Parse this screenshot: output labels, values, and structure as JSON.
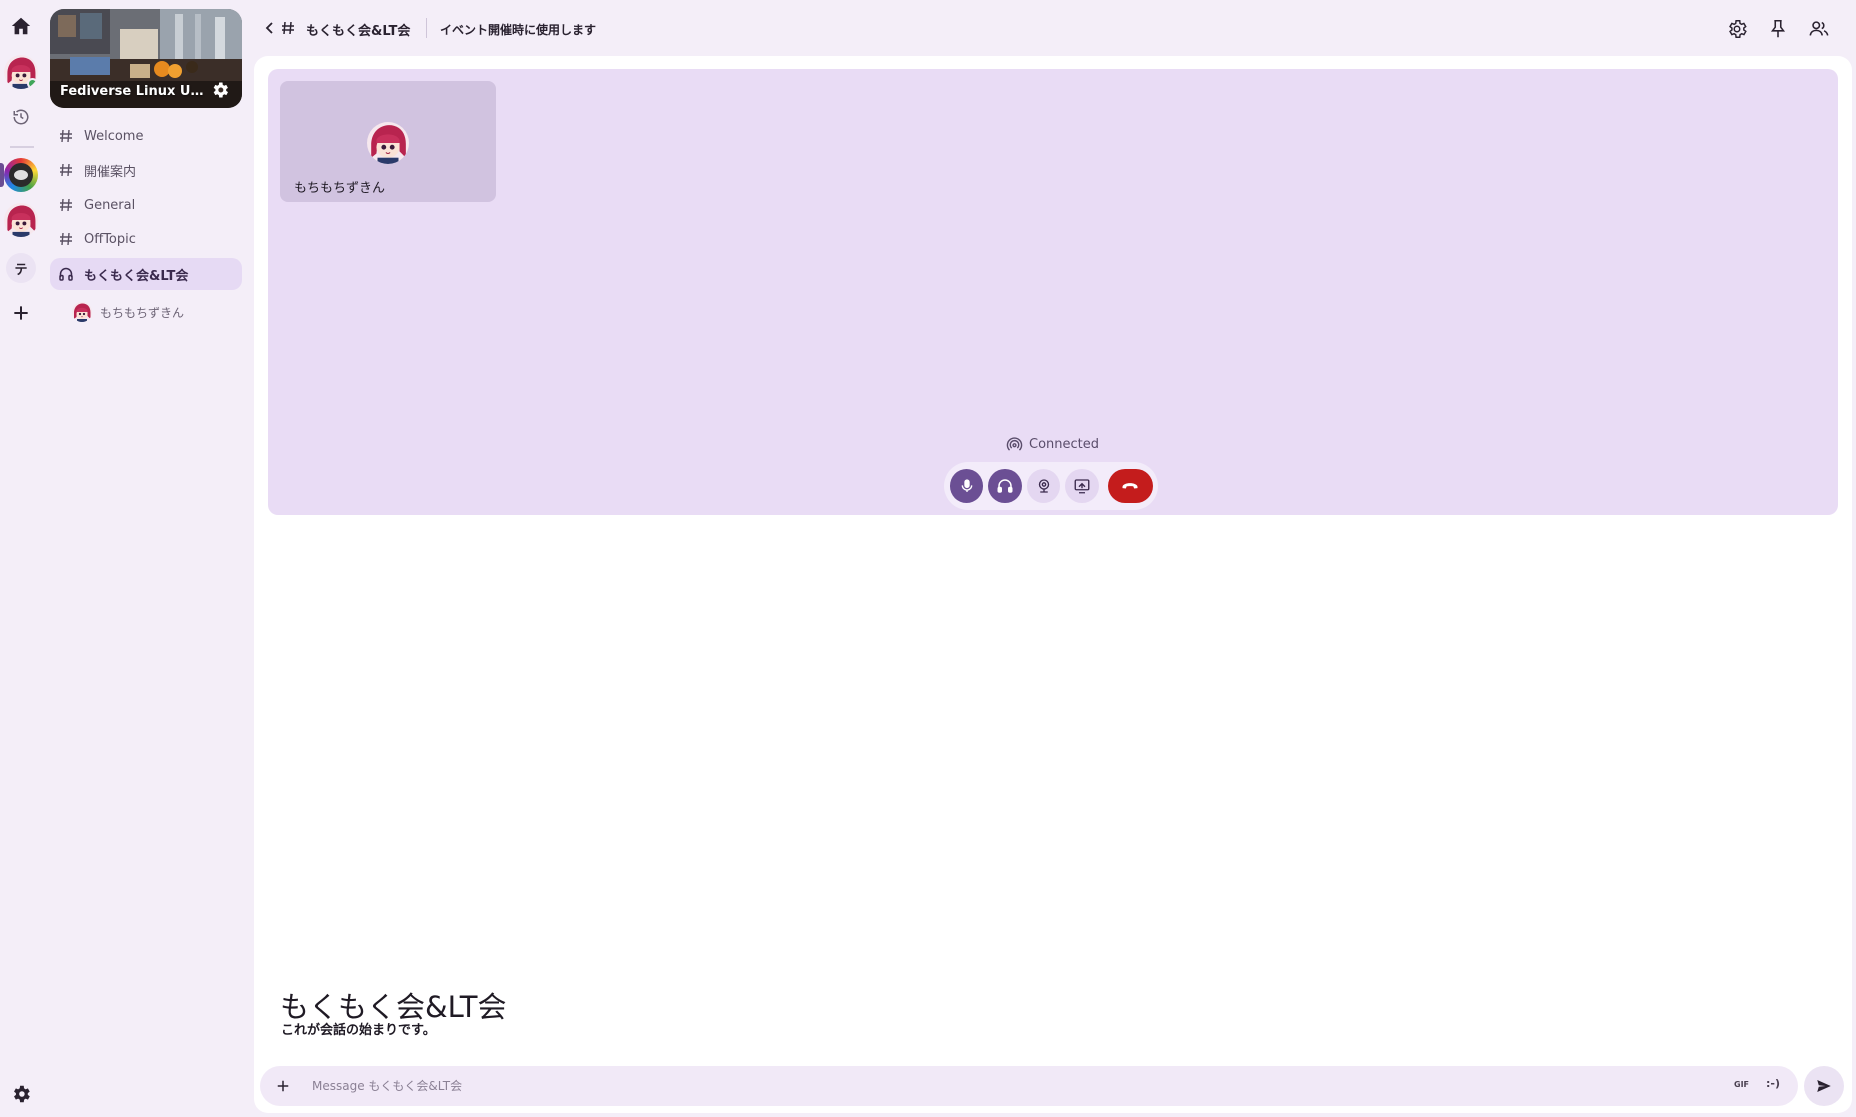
{
  "rail": {
    "icons": [
      "home-icon",
      "user-avatar",
      "history-icon",
      "server-icon",
      "server-icon",
      "text-icon",
      "plus-icon",
      "gear-icon"
    ],
    "text_server_label": "テ"
  },
  "server": {
    "name": "Fediverse Linux Us..."
  },
  "channels": [
    {
      "label": "Welcome",
      "type": "text"
    },
    {
      "label": "開催案内",
      "type": "text"
    },
    {
      "label": "General",
      "type": "text"
    },
    {
      "label": "OffTopic",
      "type": "text"
    },
    {
      "label": "もくもく会&LT会",
      "type": "voice",
      "active": true
    }
  ],
  "voice_members": [
    "もちもちずきん"
  ],
  "header": {
    "title": "もくもく会&LT会",
    "topic": "イベント開催時に使用します"
  },
  "call": {
    "participant_name": "もちもちずきん",
    "status": "Connected"
  },
  "welcome": {
    "title": "もくもく会&LT会",
    "subtitle": "これが会話の始まりです。"
  },
  "composer": {
    "placeholder": "Message もくもく会&LT会",
    "gif_label": "GIF",
    "emoji_label": ":-)"
  },
  "colors": {
    "accent": "#6b4f94",
    "call_bg": "#e9dcf5",
    "hangup": "#c41c1c",
    "status_online": "#3fa65a"
  }
}
